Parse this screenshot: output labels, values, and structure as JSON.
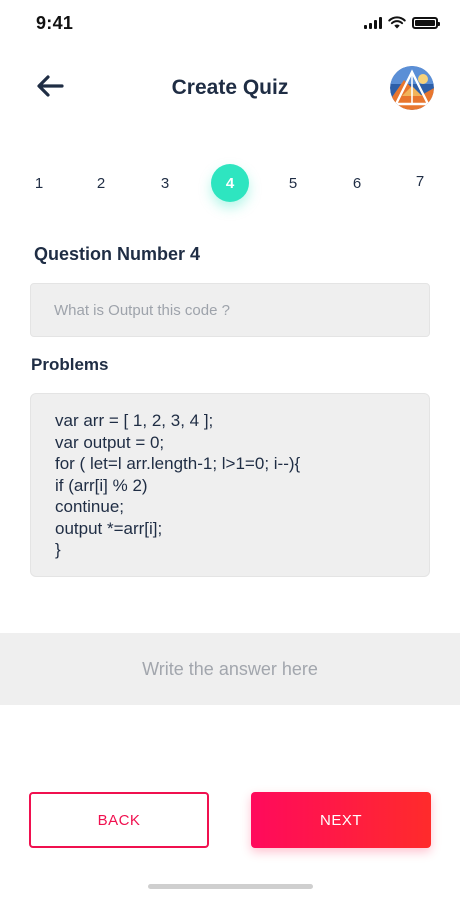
{
  "status_bar": {
    "time": "9:41",
    "icons": [
      "signal-icon",
      "wifi-icon",
      "battery-icon"
    ]
  },
  "header": {
    "title": "Create Quiz",
    "back_icon": "back-arrow-icon",
    "avatar_icon": "avatar"
  },
  "steps": {
    "items": [
      "1",
      "2",
      "3",
      "4",
      "5",
      "6",
      "7"
    ],
    "active": "4",
    "active_color": "#2ee5c0"
  },
  "question": {
    "label": "Question Number 4",
    "value": "",
    "placeholder": "What is Output this code ?"
  },
  "problems": {
    "label": "Problems",
    "code_lines": [
      "var arr = [ 1, 2, 3, 4 ];",
      "var output = 0;",
      "for ( let=l arr.length-1; l>1=0; i--){",
      "if (arr[i] % 2)",
      "continue;",
      "output *=arr[i];",
      "}"
    ]
  },
  "answer": {
    "value": "",
    "placeholder": "Write the answer here"
  },
  "buttons": {
    "back_label": "BACK",
    "next_label": "NEXT",
    "accent_color": "#f0104f"
  }
}
